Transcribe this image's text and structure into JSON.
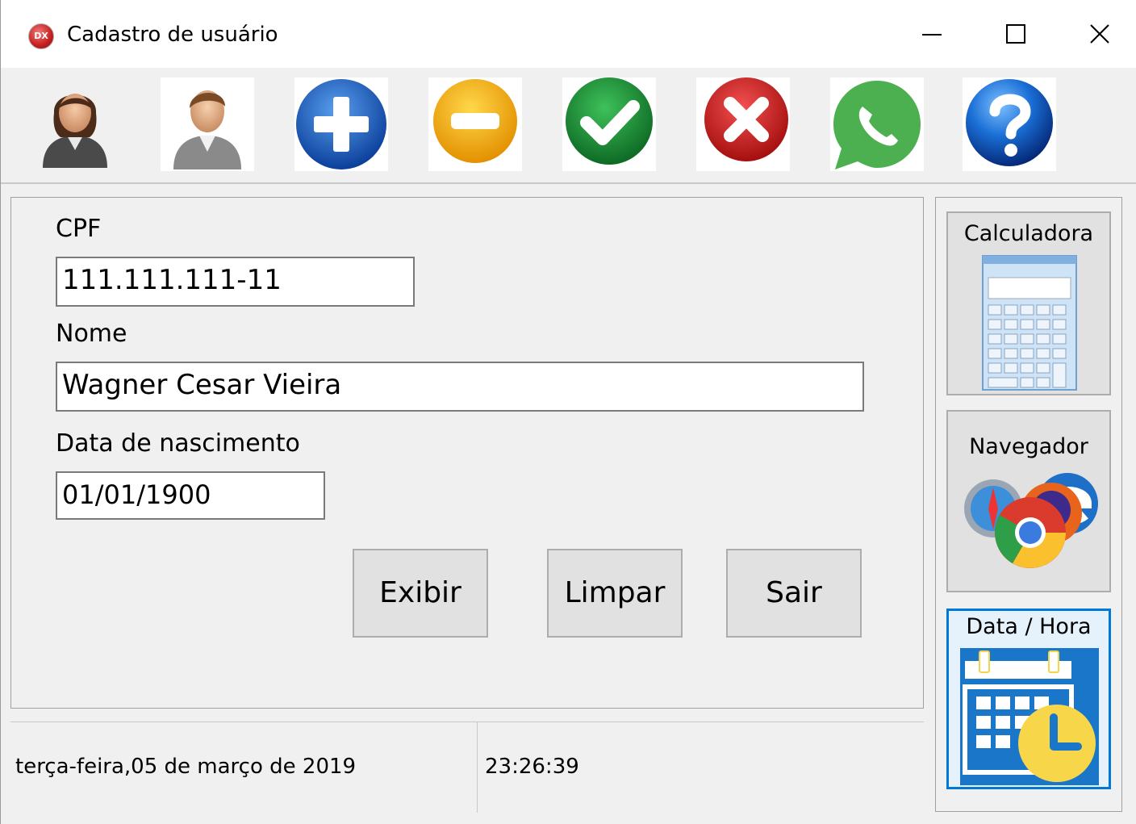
{
  "window": {
    "icon_text": "DX",
    "title": "Cadastro de usuário",
    "controls": [
      "minimize-icon",
      "maximize-icon",
      "close-icon"
    ]
  },
  "toolbar": {
    "buttons": [
      {
        "icon": "user-female-icon"
      },
      {
        "icon": "user-male-icon"
      },
      {
        "icon": "plus-icon"
      },
      {
        "icon": "minus-icon"
      },
      {
        "icon": "check-icon"
      },
      {
        "icon": "x-icon"
      },
      {
        "icon": "whatsapp-icon"
      },
      {
        "icon": "help-icon"
      }
    ]
  },
  "form": {
    "cpf_label": "CPF",
    "cpf_value": "111.111.111-11",
    "nome_label": "Nome",
    "nome_value": "Wagner Cesar Vieira",
    "nascimento_label": "Data de nascimento",
    "nascimento_value": "01/01/1900",
    "buttons": {
      "exibir": "Exibir",
      "limpar": "Limpar",
      "sair": "Sair"
    }
  },
  "side": {
    "calculadora": "Calculadora",
    "navegador": "Navegador",
    "data_hora": "Data / Hora"
  },
  "status": {
    "date": "terça-feira,05 de março de 2019",
    "time": "23:26:39"
  },
  "colors": {
    "plus": "#1f5fbf",
    "minus": "#f2a900",
    "check": "#1f8f3a",
    "cross": "#d42020",
    "whatsapp": "#4caf50",
    "help": "#1a6fd6",
    "selection": "#0078d7"
  }
}
